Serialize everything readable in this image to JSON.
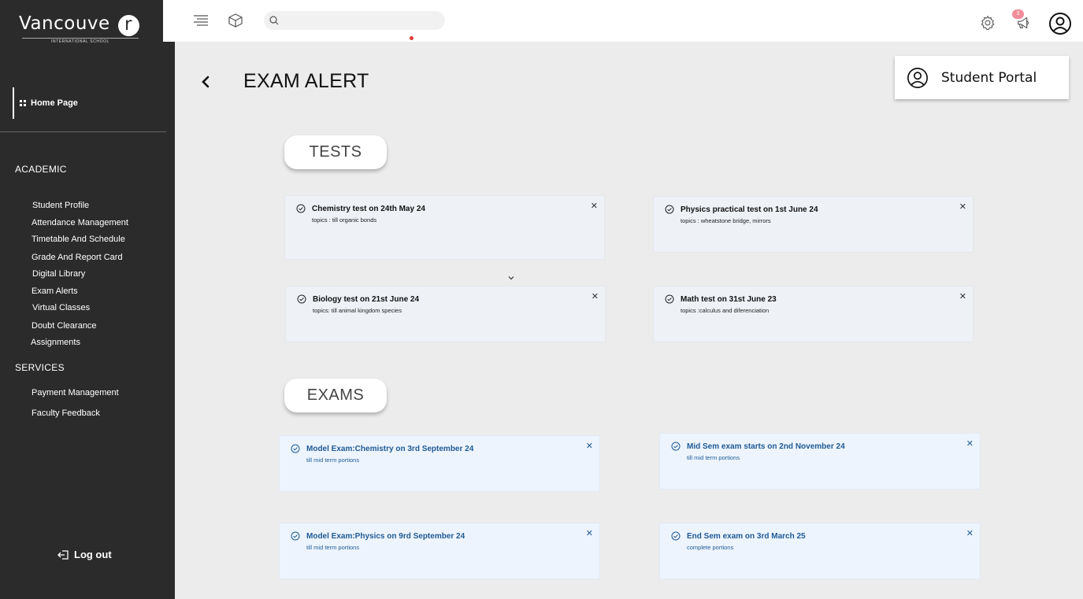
{
  "brand": {
    "name": "Vancouve",
    "name_circle": "r",
    "subtitle": "INTERNATIONAL SCHOOL"
  },
  "sidebar": {
    "home": "Home Page",
    "academic_title": "ACADEMIC",
    "academic_items": [
      {
        "label": "Student Profile"
      },
      {
        "label": "Attendance Management"
      },
      {
        "label": "Timetable And Schedule"
      },
      {
        "label": "Grade And Report Card"
      },
      {
        "label": "Digital Library"
      },
      {
        "label": "Exam Alerts"
      },
      {
        "label": "Virtual Classes"
      },
      {
        "label": "Doubt Clearance"
      },
      {
        "label": "Assignments"
      }
    ],
    "services_title": "SERVICES",
    "services_items": [
      {
        "label": "Payment Management"
      },
      {
        "label": "Faculty Feedback"
      }
    ],
    "logout": "Log out"
  },
  "topbar": {
    "search_placeholder": "",
    "notification_count": "3"
  },
  "page": {
    "title": "EXAM ALERT",
    "portal_label": "Student Portal",
    "tests_label": "TESTS",
    "exams_label": "EXAMS"
  },
  "tests": [
    {
      "title": "Chemistry test on 24th May  24",
      "sub": "topics : till organic bonds"
    },
    {
      "title": "Physics practical test on 1st June 24",
      "sub": "topics : wheatstone bridge, mirrors"
    },
    {
      "title": "Biology test on 21st June 24",
      "sub": "topics: till animal kingdom species"
    },
    {
      "title": "Math test on 31st June 23",
      "sub": "topics :calculus and diferenciation"
    }
  ],
  "exams": [
    {
      "title": "Model Exam:Chemistry on  3rd September 24",
      "sub": "till mid term portions"
    },
    {
      "title": "Mid Sem exam starts on 2nd  November 24",
      "sub": "till mid term portions"
    },
    {
      "title": "Model Exam:Physics on  9rd September 24",
      "sub": "till mid term portions"
    },
    {
      "title": "End Sem exam on 3rd March 25",
      "sub": "complete portions"
    }
  ],
  "close_glyph": "✕",
  "colors": {
    "sidebar": "#2b2b2b",
    "exam_text": "#1f5a96",
    "badge": "#f28b9a",
    "background": "#ececec"
  }
}
